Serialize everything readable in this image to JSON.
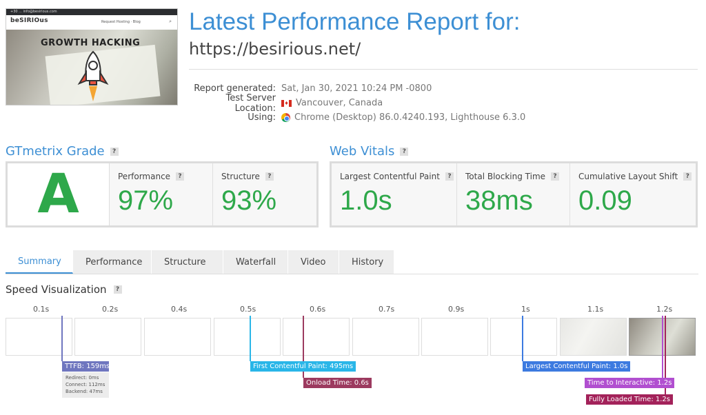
{
  "thumbnail": {
    "logo": "beSIRIOus",
    "menu": "Request Hosting · Blog",
    "topbar": "+30 ... info@besirious.com",
    "headline": "GROWTH HACKING"
  },
  "header": {
    "title": "Latest Performance Report for:",
    "url": "https://besirious.net/"
  },
  "meta": {
    "report_generated_label": "Report generated:",
    "report_generated_value": "Sat, Jan 30, 2021 10:24 PM -0800",
    "server_label": "Test Server Location:",
    "server_value": "Vancouver, Canada",
    "using_label": "Using:",
    "using_value": "Chrome (Desktop) 86.0.4240.193, Lighthouse 6.3.0"
  },
  "grade": {
    "heading": "GTmetrix Grade",
    "letter": "A",
    "performance_label": "Performance",
    "performance_value": "97%",
    "structure_label": "Structure",
    "structure_value": "93%"
  },
  "vitals": {
    "heading": "Web Vitals",
    "lcp_label": "Largest Contentful Paint",
    "lcp_value": "1.0s",
    "tbt_label": "Total Blocking Time",
    "tbt_value": "38ms",
    "cls_label": "Cumulative Layout Shift",
    "cls_value": "0.09"
  },
  "tabs": [
    "Summary",
    "Performance",
    "Structure",
    "Waterfall",
    "Video",
    "History"
  ],
  "active_tab": "Summary",
  "speed": {
    "heading": "Speed Visualization",
    "ticks": [
      "0.1s",
      "0.2s",
      "0.4s",
      "0.5s",
      "0.6s",
      "0.7s",
      "0.9s",
      "1s",
      "1.1s",
      "1.2s"
    ],
    "ttfb": "TTFB: 159ms",
    "ttfb_redirect": "Redirect: 0ms",
    "ttfb_connect": "Connect: 112ms",
    "ttfb_backend": "Backend: 47ms",
    "fcp": "First Contentful Paint: 495ms",
    "onload": "Onload Time: 0.6s",
    "lcp": "Largest Contentful Paint: 1.0s",
    "tti": "Time to Interactive: 1.2s",
    "fully_loaded": "Fully Loaded Time: 1.2s"
  },
  "colors": {
    "accent": "#3d8fd4",
    "grade_green": "#2ea84a",
    "ttfb": "#6f76bf",
    "fcp": "#29b6e8",
    "onload": "#9c3a5f",
    "lcp": "#3c7ae0",
    "tti": "#b14fd0",
    "fully_loaded": "#a3225a"
  }
}
